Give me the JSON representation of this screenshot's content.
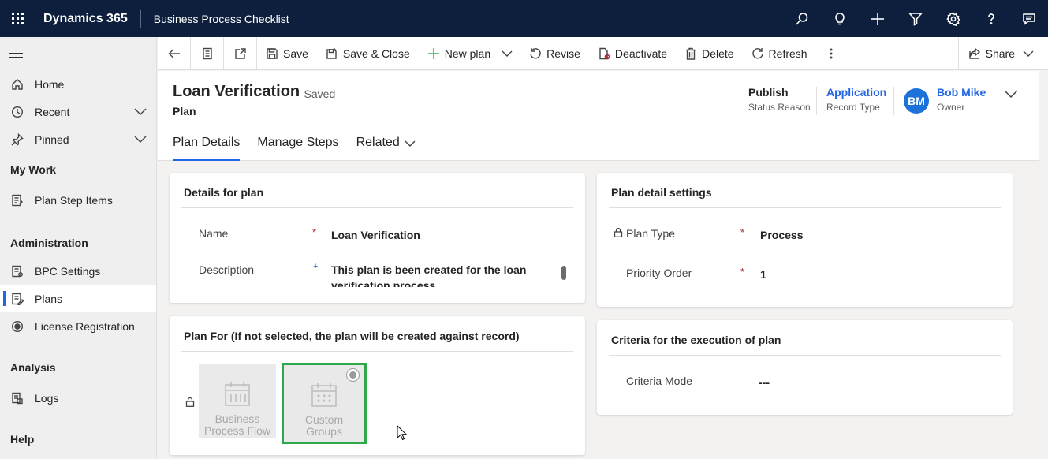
{
  "topbar": {
    "app_name": "Dynamics 365",
    "area_name": "Business Process Checklist",
    "icons": [
      "search-icon",
      "lightbulb-icon",
      "plus-icon",
      "filter-icon",
      "gear-icon",
      "help-icon",
      "chat-icon"
    ]
  },
  "sidebar": {
    "top_items": [
      {
        "label": "Home",
        "icon": "home-icon"
      },
      {
        "label": "Recent",
        "icon": "clock-icon"
      },
      {
        "label": "Pinned",
        "icon": "pin-icon"
      }
    ],
    "sections": [
      {
        "title": "My Work",
        "items": [
          {
            "label": "Plan Step Items",
            "icon": "checklist-icon"
          }
        ]
      },
      {
        "title": "Administration",
        "items": [
          {
            "label": "BPC Settings",
            "icon": "settings-doc-icon"
          },
          {
            "label": "Plans",
            "icon": "plans-icon"
          },
          {
            "label": "License Registration",
            "icon": "license-icon"
          }
        ]
      },
      {
        "title": "Analysis",
        "items": [
          {
            "label": "Logs",
            "icon": "logs-icon"
          }
        ]
      },
      {
        "title": "Help",
        "items": []
      }
    ],
    "active_item": "Plans"
  },
  "command_bar": {
    "save": "Save",
    "save_close": "Save & Close",
    "new_plan": "New plan",
    "revise": "Revise",
    "deactivate": "Deactivate",
    "delete": "Delete",
    "refresh": "Refresh",
    "share": "Share"
  },
  "record": {
    "title": "Loan Verification",
    "saved_status": "- Saved",
    "entity": "Plan",
    "status_reason_value": "Publish",
    "status_reason_label": "Status Reason",
    "record_type_value": "Application",
    "record_type_label": "Record Type",
    "owner_initials": "BM",
    "owner_name": "Bob Mike",
    "owner_label": "Owner"
  },
  "tabs": [
    {
      "label": "Plan Details",
      "active": true
    },
    {
      "label": "Manage Steps",
      "active": false
    },
    {
      "label": "Related",
      "active": false
    }
  ],
  "details_card": {
    "title": "Details for plan",
    "name_label": "Name",
    "name_value": "Loan Verification",
    "description_label": "Description",
    "description_value": "This plan is been created for the loan verification process",
    "required_mark": "*",
    "recommended_mark": "+"
  },
  "settings_card": {
    "title": "Plan detail settings",
    "plan_type_label": "Plan Type",
    "plan_type_value": "Process",
    "priority_label": "Priority Order",
    "priority_value": "1",
    "required_mark": "*"
  },
  "plan_for_card": {
    "title": "Plan For (If not selected, the plan will be created against record)",
    "options": [
      {
        "label_line1": "Business",
        "label_line2": "Process Flow",
        "selected": false
      },
      {
        "label_line1": "Custom",
        "label_line2": "Groups",
        "selected": true
      }
    ],
    "selected_border_color": "#2ea84a"
  },
  "criteria_card": {
    "title": "Criteria for the execution of plan",
    "mode_label": "Criteria Mode",
    "mode_value": "---"
  },
  "colors": {
    "topbar_bg": "#0d1f3c",
    "accent": "#2266e3",
    "required": "#a4262c",
    "avatar": "#1c72d9"
  }
}
